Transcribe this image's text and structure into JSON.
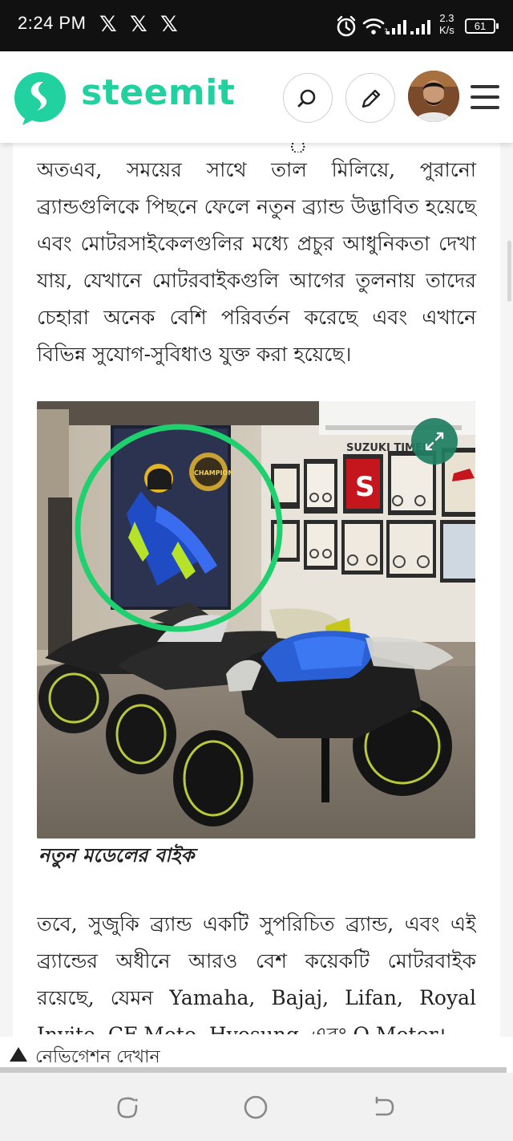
{
  "status_bar": {
    "time": "2:24 PM",
    "notification_icons": [
      "x-icon",
      "x-icon",
      "x-icon"
    ],
    "net_speed_value": "2.3",
    "net_speed_unit": "K/s",
    "battery": "61"
  },
  "header": {
    "brand": "steemit",
    "brand_color": "#21d19f",
    "search_icon": "search-icon",
    "edit_icon": "pencil-icon",
    "menu_icon": "hamburger-menu-icon"
  },
  "article": {
    "partial_top_char": "ু",
    "paragraph_1": "অতএব, সময়ের সাথে তাল মিলিয়ে, পুরানো ব্র্যান্ডগুলিকে পিছনে ফেলে নতুন ব্র্যান্ড উদ্ভাবিত হয়েছে এবং মোটরসাইকেলগুলির মধ্যে প্রচুর আধুনিকতা দেখা যায়, যেখানে মোটরবাইকগুলি আগের তুলনায় তাদের চেহারা অনেক বেশি পরিবর্তন করেছে এবং এখানে বিভিন্ন সুযোগ-সুবিধাও যুক্ত করা হয়েছে।",
    "image": {
      "poster_text": "CHAMPION",
      "wall_banner": "SUZUKI TIMELI",
      "expand_icon": "expand-icon",
      "highlight_color": "#1fd06e"
    },
    "caption": "নতুন মডেলের বাইক",
    "paragraph_2": "তবে, সুজুকি ব্র্যান্ড একটি সুপরিচিত ব্র্যান্ড, এবং এই ব্র্যান্ডের অধীনে আরও বেশ কয়েকটি মোটরবাইক রয়েছে, যেমন Yamaha, Bajaj, Lifan, Royal Invite, CF Moto, Hyosung, এবং Q Motor।"
  },
  "navigation_hint": {
    "label": "নেভিগেশন দেখান",
    "icon": "triangle-up-icon"
  },
  "system_nav": {
    "recents_icon": "recents-icon",
    "home_icon": "home-icon",
    "back_icon": "back-icon"
  }
}
